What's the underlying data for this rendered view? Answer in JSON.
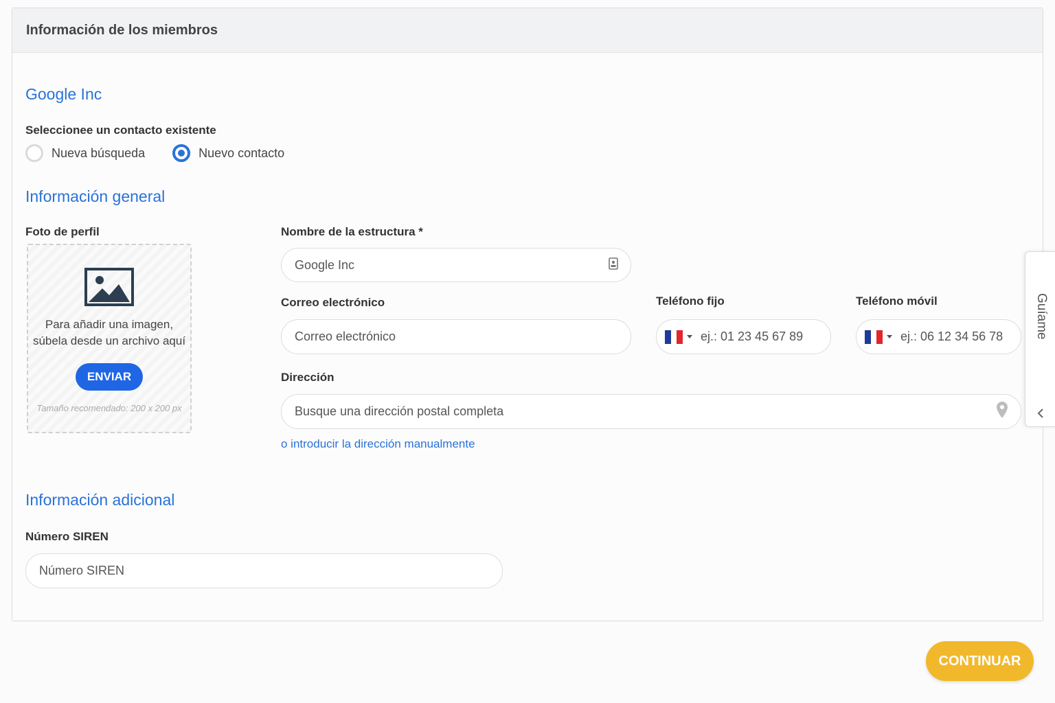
{
  "header": {
    "title": "Información de los miembros"
  },
  "company": {
    "name": "Google Inc"
  },
  "contact_select": {
    "label": "Seleccionee un contacto existente",
    "options": [
      {
        "label": "Nueva búsqueda",
        "checked": false
      },
      {
        "label": "Nuevo contacto",
        "checked": true
      }
    ]
  },
  "general": {
    "title": "Información general",
    "photo": {
      "label": "Foto de perfil",
      "text_line1": "Para añadir una imagen,",
      "text_line2": "súbela desde un archivo aquí",
      "button": "ENVIAR",
      "note": "Tamaño recomendado: 200 x 200 px"
    },
    "structure_name": {
      "label": "Nombre de la estructura *",
      "value": "Google Inc"
    },
    "email": {
      "label": "Correo electrónico",
      "placeholder": "Correo electrónico"
    },
    "phone_fixed": {
      "label": "Teléfono fijo",
      "placeholder": "ej.: 01 23 45 67 89"
    },
    "phone_mobile": {
      "label": "Teléfono móvil",
      "placeholder": "ej.: 06 12 34 56 78"
    },
    "address": {
      "label": "Dirección",
      "placeholder": "Busque una dirección postal completa",
      "manual_link": "o introducir la dirección manualmente"
    }
  },
  "additional": {
    "title": "Información adicional",
    "siren": {
      "label": "Número SIREN",
      "placeholder": "Número SIREN"
    }
  },
  "continue_button": "CONTINUAR",
  "guide_tab": {
    "label": "Guíame"
  },
  "colors": {
    "accent": "#2a72d8",
    "button_blue": "#1f66e5",
    "continue": "#f2b82c"
  },
  "icons": [
    "image-icon",
    "contact-card-icon",
    "france-flag-icon",
    "caret-down-icon",
    "map-pin-icon",
    "chevron-left-icon"
  ]
}
